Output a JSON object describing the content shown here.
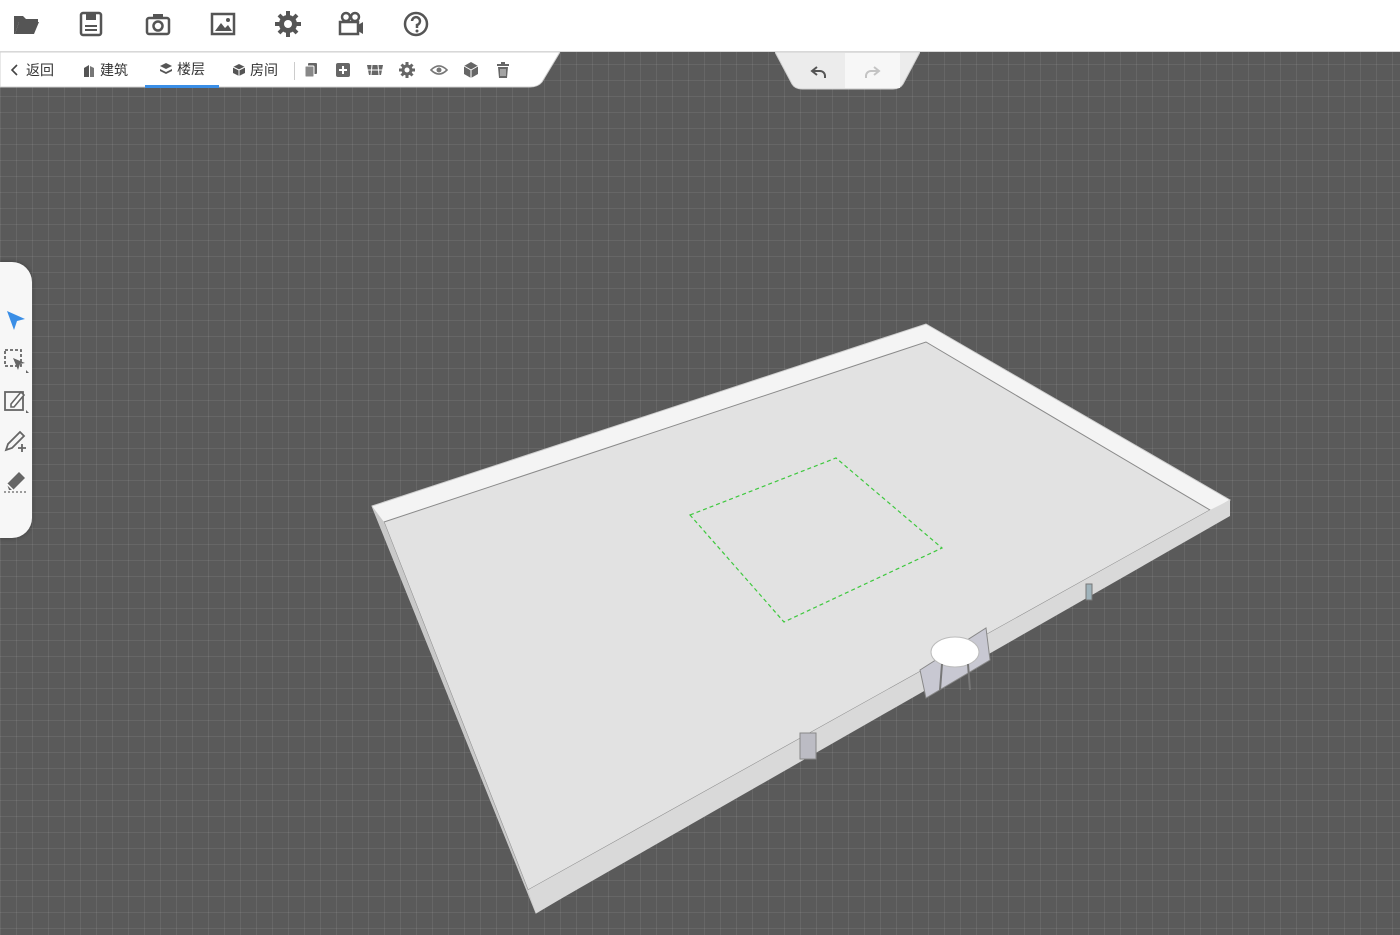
{
  "toolbar": {
    "icons": [
      "open-folder-icon",
      "save-icon",
      "camera-icon",
      "image-icon",
      "settings-icon",
      "video-camera-icon",
      "help-icon"
    ]
  },
  "subbar": {
    "back_label": "返回",
    "building_label": "建筑",
    "floor_label": "楼层",
    "room_label": "房间",
    "active_tab": "楼层",
    "tools": [
      "copy-icon",
      "add-icon",
      "floor-slab-icon",
      "gear-icon",
      "eye-icon",
      "cube-icon",
      "trash-icon"
    ]
  },
  "history": {
    "undo": "undo-icon",
    "redo": "redo-icon"
  },
  "left_tools": [
    "select-arrow-icon",
    "box-select-icon",
    "edit-shape-icon",
    "pen-add-icon",
    "eraser-icon"
  ],
  "colors": {
    "accent": "#3a8ee6",
    "selection_outline": "#3ec83e",
    "background": "#5a5a5a",
    "floor": "#e2e2e2"
  }
}
